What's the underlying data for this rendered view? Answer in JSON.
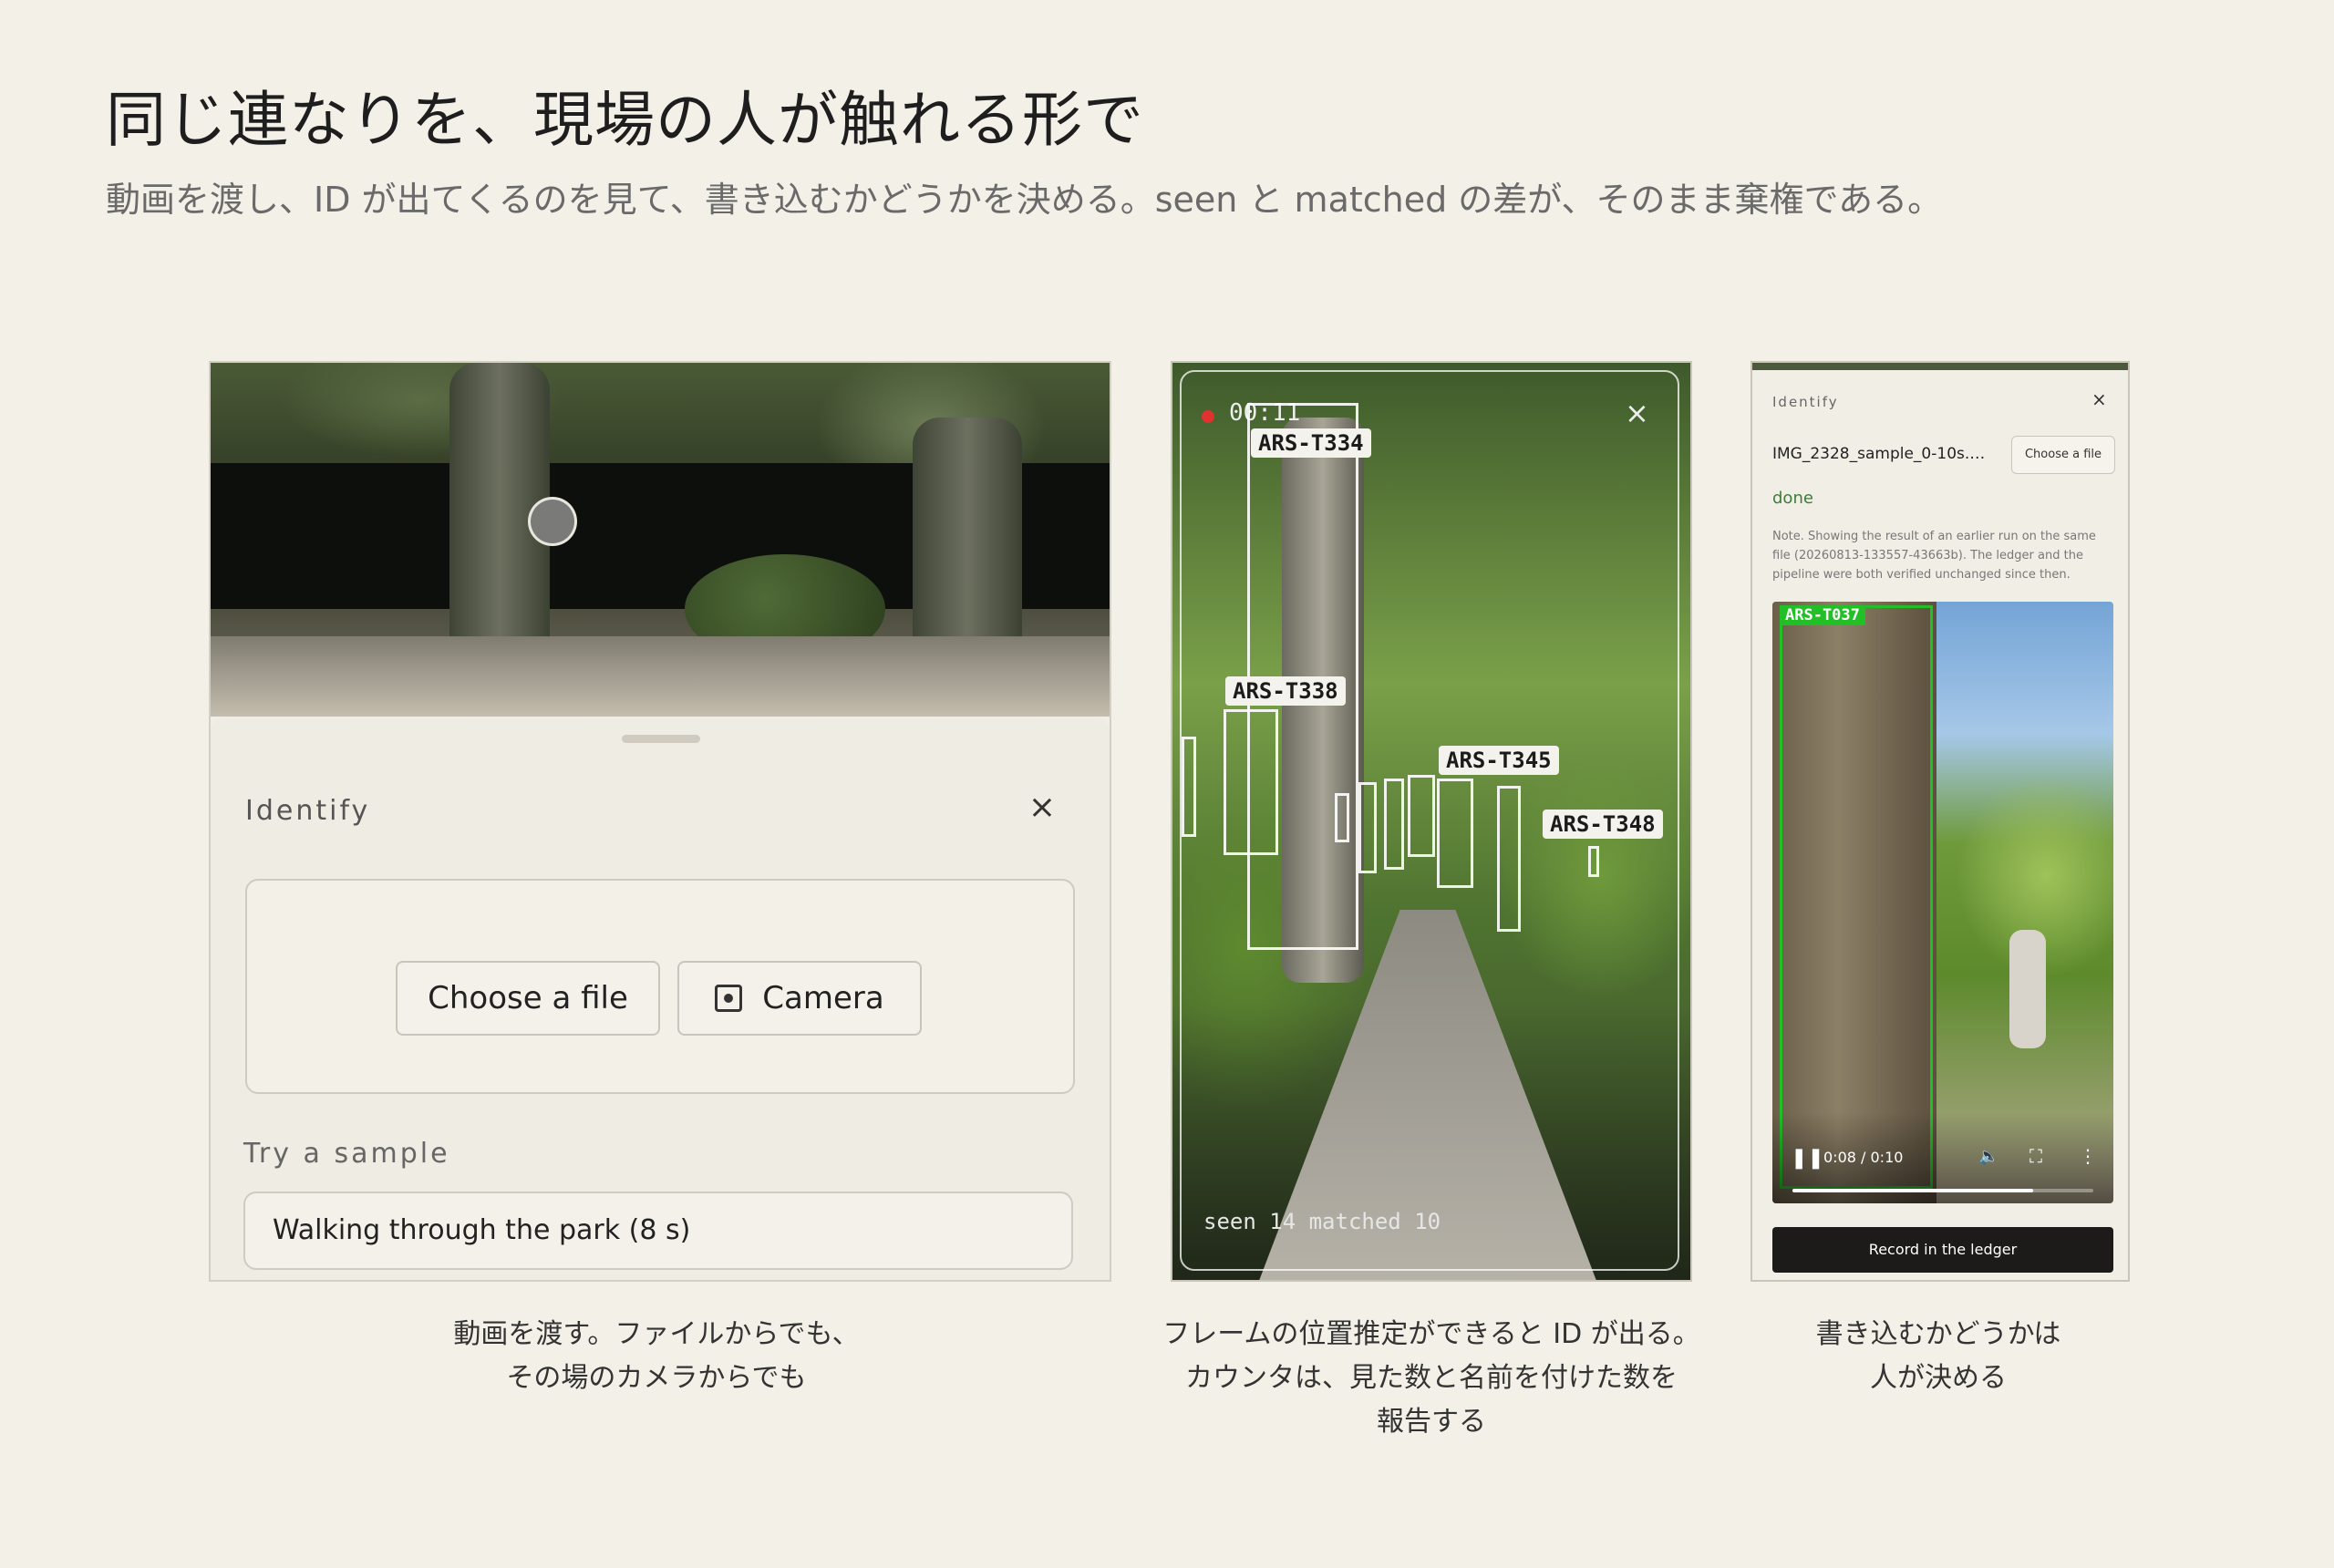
{
  "heading": "同じ連なりを、現場の人が触れる形で",
  "subheading": "動画を渡し、ID が出てくるのを見て、書き込むかどうかを決める。seen と matched の差が、そのまま棄権である。",
  "panel1": {
    "title": "Identify",
    "close_icon": "×",
    "buttons": {
      "choose_file": "Choose a file",
      "camera": "Camera"
    },
    "sample_label": "Try a sample",
    "sample_value": "Walking through the park (8 s)",
    "caption_line1": "動画を渡す。ファイルからでも、",
    "caption_line2": "その場のカメラからでも"
  },
  "panel2": {
    "rec_time": "00:11",
    "close_icon": "×",
    "detections": [
      {
        "id": "ARS-T334"
      },
      {
        "id": "ARS-T338"
      },
      {
        "id": "ARS-T345"
      },
      {
        "id": "ARS-T348"
      }
    ],
    "counter_text": "seen 14  matched 10",
    "caption_line1": "フレームの位置推定ができると ID が出る。",
    "caption_line2": "カウンタは、見た数と名前を付けた数を",
    "caption_line3": "報告する"
  },
  "panel3": {
    "title": "Identify",
    "close_icon": "×",
    "file_name": "IMG_2328_sample_0-10s.…",
    "choose_file": "Choose a file",
    "status": "done",
    "note": "Note. Showing the result of an earlier run on the same file (20260813-133557-43663b). The ledger and the pipeline were both verified unchanged since then.",
    "detection_id": "ARS-T037",
    "video_time": "0:08 / 0:10",
    "video_progress": 0.8,
    "record_button": "Record in the ledger",
    "caption_line1": "書き込むかどうかは",
    "caption_line2": "人が決める"
  },
  "colors": {
    "background": "#f3f0e8",
    "accent_green": "#22c026",
    "record_dot": "#e0322f",
    "status_green": "#3f7b3b"
  }
}
